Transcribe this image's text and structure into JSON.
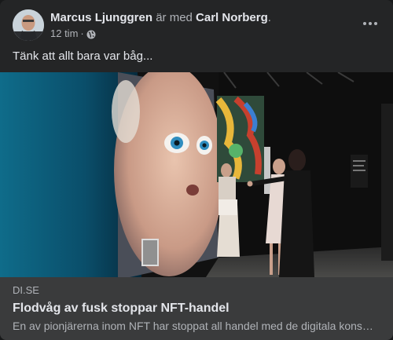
{
  "post": {
    "author": "Marcus Ljunggren",
    "with_text": "är med",
    "tagged": "Carl Norberg",
    "period": ".",
    "time": "12 tim",
    "dot": "·",
    "audience_icon": "globe-icon",
    "menu_icon": "more-options-icon",
    "text": "Tänk att allt bara var båg..."
  },
  "link": {
    "domain": "DI.SE",
    "title": "Flodvåg av fusk stoppar NFT-handel",
    "description": "En av pionjärerna inom NFT har stoppat all handel med de digitala konstverken."
  }
}
